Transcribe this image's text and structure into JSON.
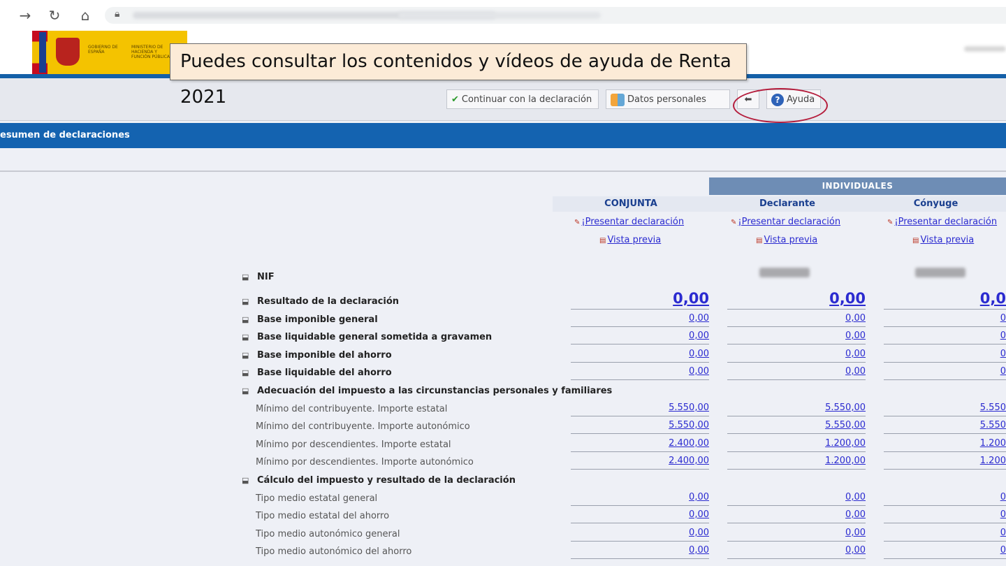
{
  "browser": {
    "back_icon": "arrow-right-icon",
    "reload_icon": "reload-icon",
    "home_icon": "home-icon"
  },
  "header": {
    "logo_text_1": "GOBIERNO DE ESPAÑA",
    "logo_text_2": "MINISTERIO DE HACIENDA Y FUNCIÓN PÚBLICA"
  },
  "tooltip": {
    "text": "Puedes consultar los contenidos y vídeos de ayuda de Renta 2021"
  },
  "toolbar": {
    "continue_label": "Continuar con la declaración",
    "personal_label": "Datos personales",
    "help_label": "Ayuda"
  },
  "section": {
    "title": "esumen de declaraciones"
  },
  "columns": {
    "individuales": "INDIVIDUALES",
    "conjunta": "CONJUNTA",
    "declarante": "Declarante",
    "conyuge": "Cónyuge",
    "present_link": "¡Presentar declaración",
    "preview_link": "Vista previa"
  },
  "rows": [
    {
      "label": "NIF",
      "bold": true,
      "values": [
        "",
        "",
        ""
      ]
    },
    {
      "label": "Resultado de la declaración",
      "bold": true,
      "values": [
        "0,00",
        "0,00",
        "0,0"
      ]
    },
    {
      "label": "Base imponible general",
      "bold": true,
      "values": [
        "0,00",
        "0,00",
        "0"
      ]
    },
    {
      "label": "Base liquidable general sometida a gravamen",
      "bold": true,
      "values": [
        "0,00",
        "0,00",
        "0"
      ]
    },
    {
      "label": "Base imponible del ahorro",
      "bold": true,
      "values": [
        "0,00",
        "0,00",
        "0"
      ]
    },
    {
      "label": "Base liquidable del ahorro",
      "bold": true,
      "values": [
        "0,00",
        "0,00",
        "0"
      ]
    },
    {
      "label": "Adecuación del impuesto a las circunstancias personales y familiares",
      "bold": true,
      "values": [
        "",
        "",
        ""
      ]
    },
    {
      "label": "Mínimo del contribuyente. Importe estatal",
      "bold": false,
      "values": [
        "5.550,00",
        "5.550,00",
        "5.550"
      ]
    },
    {
      "label": "Mínimo del contribuyente. Importe autonómico",
      "bold": false,
      "values": [
        "5.550,00",
        "5.550,00",
        "5.550"
      ]
    },
    {
      "label": "Mínimo por descendientes. Importe estatal",
      "bold": false,
      "values": [
        "2.400,00",
        "1.200,00",
        "1.200"
      ]
    },
    {
      "label": "Mínimo por descendientes. Importe autonómico",
      "bold": false,
      "values": [
        "2.400,00",
        "1.200,00",
        "1.200"
      ]
    },
    {
      "label": "Cálculo del impuesto y resultado de la declaración",
      "bold": true,
      "values": [
        "",
        "",
        ""
      ]
    },
    {
      "label": "Tipo medio estatal general",
      "bold": false,
      "values": [
        "0,00",
        "0,00",
        "0"
      ]
    },
    {
      "label": "Tipo medio estatal del ahorro",
      "bold": false,
      "values": [
        "0,00",
        "0,00",
        "0"
      ]
    },
    {
      "label": "Tipo medio autonómico general",
      "bold": false,
      "values": [
        "0,00",
        "0,00",
        "0"
      ]
    },
    {
      "label": "Tipo medio autonómico del ahorro",
      "bold": false,
      "values": [
        "0,00",
        "0,00",
        "0"
      ]
    }
  ]
}
